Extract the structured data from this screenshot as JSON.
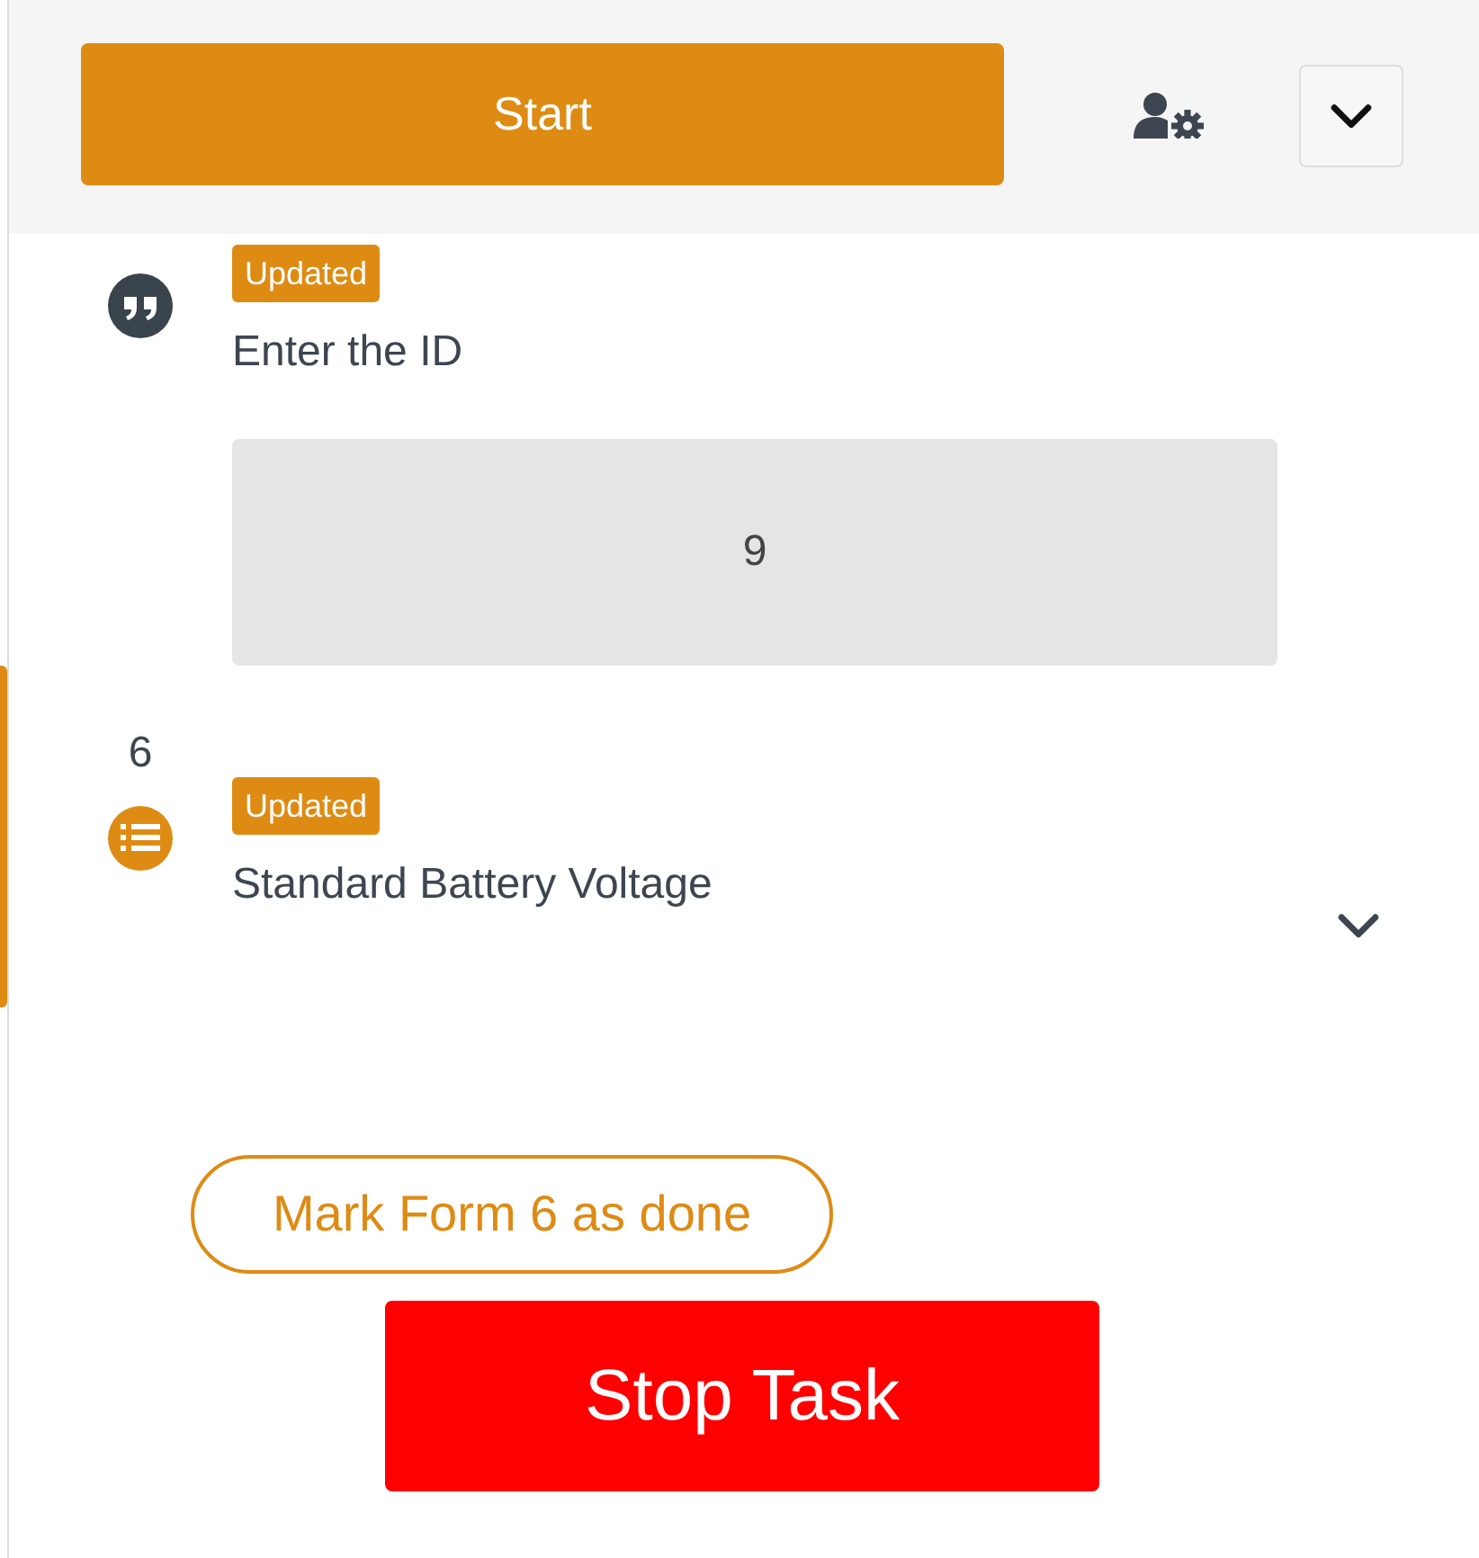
{
  "header": {
    "start_button": "Start"
  },
  "items": [
    {
      "kind": "text",
      "badge": "Updated",
      "label": "Enter the ID",
      "value": "9"
    },
    {
      "kind": "choice",
      "number": "6",
      "badge": "Updated",
      "label": "Standard Battery Voltage",
      "expanded": false
    }
  ],
  "mark_done_button": "Mark Form 6 as done",
  "stop_button": "Stop Task"
}
